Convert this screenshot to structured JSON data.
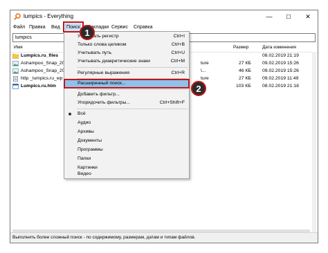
{
  "window": {
    "title": "lumpics - Everything",
    "minimize": "—",
    "maximize": "☐",
    "close": "✕"
  },
  "menu": [
    "Файл",
    "Правка",
    "Вид",
    "Поиск",
    "Закладки",
    "Сервис",
    "Справка"
  ],
  "search": {
    "value": "lumpics",
    "placeholder": ""
  },
  "columns": {
    "name": "Имя",
    "size": "Размер",
    "date": "Дата изменения"
  },
  "rows": [
    {
      "name": "Lumpics.ru_files",
      "size": "",
      "date": "08.02.2019 21:19",
      "icon": "folder-icon"
    },
    {
      "name": "Ashampoo_Snap_2019",
      "path_tail": "ture",
      "size": "27 КБ",
      "date": "09.02.2019 15:26",
      "icon": "image-file-icon"
    },
    {
      "name": "Ashampoo_Snap_2019",
      "path_tail": "\\...",
      "size": "46 КБ",
      "date": "09.02.2019 15:26",
      "icon": "image-file-icon"
    },
    {
      "name": "http _lumpics.ru_wp",
      "path_tail": "ture",
      "size": "27 КБ",
      "date": "09.02.2019 11:49",
      "icon": "text-file-icon"
    },
    {
      "name": "Lumpics.ru.htm",
      "path_tail": "",
      "size": "103 КБ",
      "date": "08.02.2019 21:18",
      "icon": "web-page-icon"
    }
  ],
  "dropdown": {
    "items": [
      {
        "label": "Учитывать регистр",
        "shortcut": "Ctrl+I"
      },
      {
        "label": "Только слова целиком",
        "shortcut": "Ctrl+B"
      },
      {
        "label": "Учитывать путь",
        "shortcut": "Ctrl+U"
      },
      {
        "label": "Учитывать диакритические знаки",
        "shortcut": "Ctrl+M"
      },
      {
        "label": "Регулярные выражения",
        "shortcut": "Ctrl+R"
      },
      {
        "label": "Расширенный поиск...",
        "shortcut": ""
      },
      {
        "label": "Добавить фильтр...",
        "shortcut": ""
      },
      {
        "label": "Упорядочить фильтры...",
        "shortcut": "Ctrl+Shift+F"
      },
      {
        "label": "Всё",
        "shortcut": ""
      },
      {
        "label": "Аудио",
        "shortcut": ""
      },
      {
        "label": "Архивы",
        "shortcut": ""
      },
      {
        "label": "Документы",
        "shortcut": ""
      },
      {
        "label": "Программы",
        "shortcut": ""
      },
      {
        "label": "Папки",
        "shortcut": ""
      },
      {
        "label": "Картинки",
        "shortcut": ""
      },
      {
        "label": "Видео",
        "shortcut": ""
      }
    ]
  },
  "callouts": {
    "first": "1",
    "second": "2"
  },
  "status": "Выполнить более сложный поиск - по содержимому, размерам, датам и типам файлов.",
  "colors": {
    "highlight": "#8fc1ea",
    "annotation_red": "#c21515",
    "menu_bg": "#f2f2f2"
  }
}
